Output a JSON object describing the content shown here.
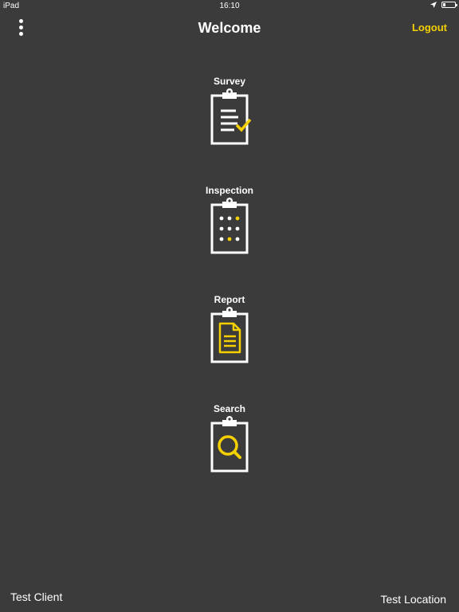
{
  "status_bar": {
    "device": "iPad",
    "time": "16:10",
    "location_icon": "location-arrow-icon",
    "battery_icon": "battery-icon"
  },
  "nav": {
    "title": "Welcome",
    "logout_label": "Logout",
    "menu_icon": "more-vertical-icon"
  },
  "menu": {
    "items": [
      {
        "label": "Survey",
        "icon": "clipboard-checklist-icon"
      },
      {
        "label": "Inspection",
        "icon": "clipboard-dots-icon"
      },
      {
        "label": "Report",
        "icon": "clipboard-document-icon"
      },
      {
        "label": "Search",
        "icon": "clipboard-search-icon"
      }
    ]
  },
  "footer": {
    "client": "Test Client",
    "location": "Test Location"
  },
  "colors": {
    "background": "#3b3b3b",
    "accent": "#f5d000",
    "text": "#ffffff"
  }
}
